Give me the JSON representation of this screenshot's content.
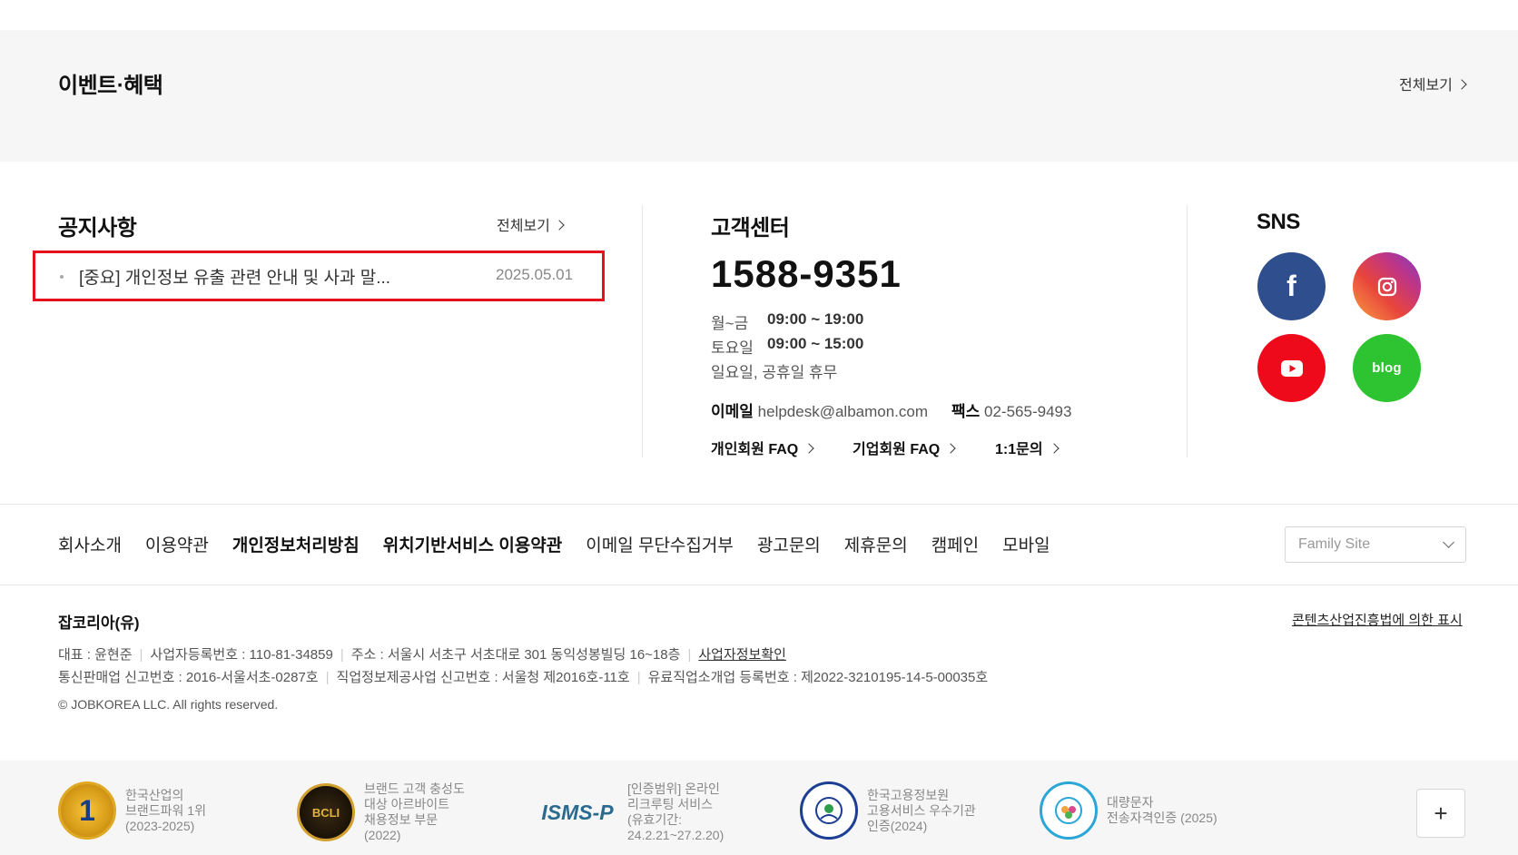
{
  "events": {
    "title": "이벤트·혜택",
    "see_all": "전체보기"
  },
  "notice": {
    "title": "공지사항",
    "see_all": "전체보기",
    "items": [
      {
        "text": "[중요] 개인정보 유출 관련 안내 및 사과 말...",
        "date": "2025.05.01"
      }
    ]
  },
  "customer_center": {
    "title": "고객센터",
    "phone": "1588-9351",
    "hours": [
      {
        "days": "월~금",
        "time": "09:00 ~ 19:00"
      },
      {
        "days": "토요일",
        "time": "09:00 ~ 15:00"
      }
    ],
    "closed": "일요일, 공휴일 휴무",
    "email_label": "이메일",
    "email": "helpdesk@albamon.com",
    "fax_label": "팩스",
    "fax": "02-565-9493",
    "links": [
      "개인회원 FAQ",
      "기업회원 FAQ",
      "1:1문의"
    ]
  },
  "sns": {
    "title": "SNS",
    "facebook_glyph": "f",
    "blog_label": "blog",
    "icons": [
      "facebook-icon",
      "instagram-icon",
      "youtube-icon",
      "blog-icon"
    ]
  },
  "footer_nav": {
    "items": [
      "회사소개",
      "이용약관",
      "개인정보처리방침",
      "위치기반서비스 이용약관",
      "이메일 무단수집거부",
      "광고문의",
      "제휴문의",
      "캠페인",
      "모바일"
    ],
    "family_site": "Family Site"
  },
  "company": {
    "name": "잡코리아(유)",
    "content_law": "콘텐츠산업진흥법에 의한 표시",
    "line1": [
      "대표 : 윤현준",
      "사업자등록번호 : 110-81-34859",
      "주소 : 서울시 서초구 서초대로 301 동익성봉빌딩 16~18층"
    ],
    "line1_link": "사업자정보확인",
    "line2": [
      "통신판매업 신고번호 : 2016-서울서초-0287호",
      "직업정보제공사업 신고번호 : 서울청 제2016호-11호",
      "유료직업소개업 등록번호 : 제2022-3210195-14-5-00035호"
    ],
    "copyright": "© JOBKOREA LLC. All rights reserved."
  },
  "certifications": [
    {
      "badge": "1",
      "text": "한국산업의\n브랜드파워 1위\n(2023-2025)"
    },
    {
      "badge": "BCLI",
      "text": "브랜드 고객 충성도\n대상 아르바이트\n채용정보 부문\n(2022)"
    },
    {
      "badge": "ISMS-P",
      "text": "[인증범위] 온라인\n리크루팅 서비스\n(유효기간:\n24.2.21~27.2.20)"
    },
    {
      "badge": "",
      "text": "한국고용정보원\n고용서비스 우수기관\n인증(2024)"
    },
    {
      "badge": "",
      "text": "대량문자\n전송자격인증 (2025)"
    }
  ],
  "plus_label": "+"
}
